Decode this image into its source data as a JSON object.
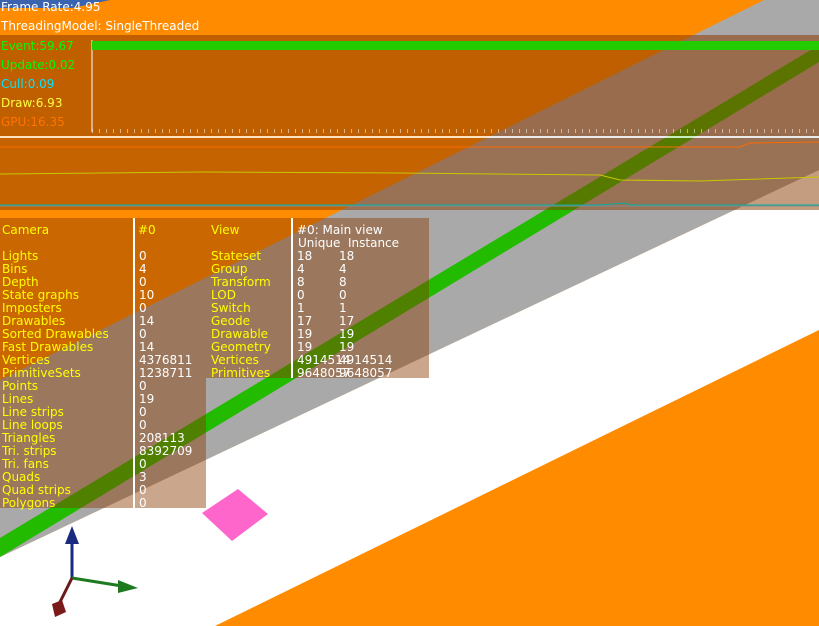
{
  "header": {
    "frame_rate": "Frame Rate:4.95",
    "threading_model": "ThreadingModel: SingleThreaded"
  },
  "timing": {
    "event": "Event:59.67",
    "update": "Update:0.02",
    "cull": "Cull:0.09",
    "draw": "Draw:6.93",
    "gpu": "GPU:16.35"
  },
  "camera_stats": {
    "title": "Camera",
    "id": "#0",
    "labels": [
      "Lights",
      "Bins",
      "Depth",
      "State graphs",
      "Imposters",
      "Drawables",
      "Sorted Drawables",
      "Fast Drawables",
      "Vertices",
      "PrimitiveSets",
      "Points",
      "Lines",
      "Line strips",
      "Line loops",
      "Triangles",
      "Tri. strips",
      "Tri. fans",
      "Quads",
      "Quad strips",
      "Polygons"
    ],
    "values": [
      "0",
      "4",
      "0",
      "10",
      "0",
      "14",
      "0",
      "14",
      "4376811",
      "1238711",
      "0",
      "19",
      "0",
      "0",
      "208113",
      "8392709",
      "0",
      "3",
      "0",
      "0"
    ]
  },
  "view_stats": {
    "title": "View",
    "id": "#0: Main view",
    "col_unique": "Unique",
    "col_instance": "Instance",
    "labels": [
      "Stateset",
      "Group",
      "Transform",
      "LOD",
      "Switch",
      "Geode",
      "Drawable",
      "Geometry",
      "Vertices",
      "Primitives"
    ],
    "unique": [
      "18",
      "4",
      "8",
      "0",
      "1",
      "17",
      "19",
      "19",
      "4914514",
      "9648057"
    ],
    "instance": [
      "18",
      "4",
      "8",
      "0",
      "1",
      "17",
      "19",
      "19",
      "4914514",
      "9648057"
    ]
  },
  "colors": {
    "orange": "#ff8c00",
    "green": "#00ff00",
    "yellow": "#ffff00",
    "cyan": "#00e5ff",
    "gpu_orange": "#ff7300"
  }
}
